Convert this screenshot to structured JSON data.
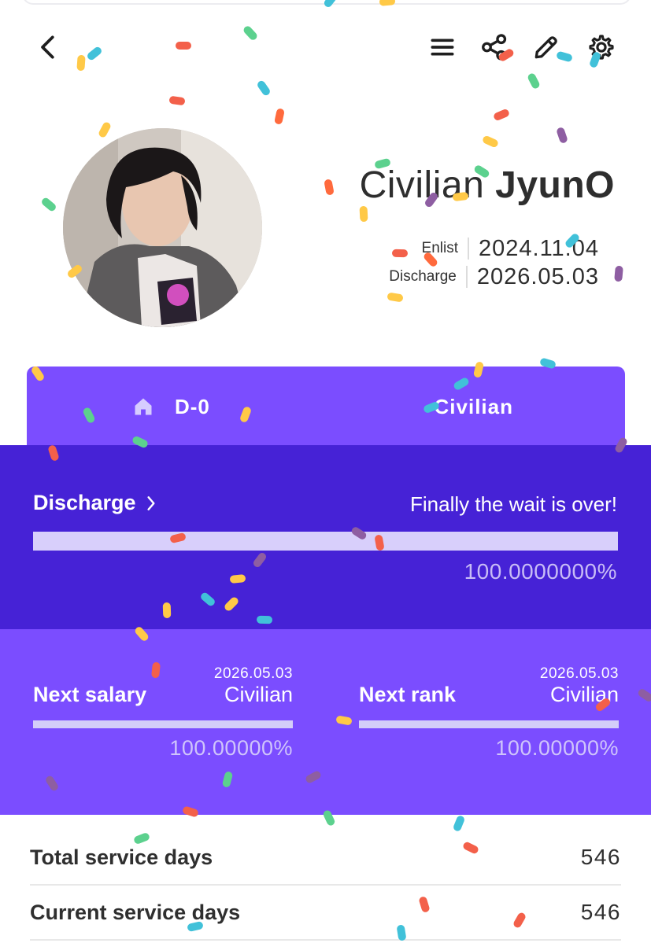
{
  "header": {
    "back_icon": "chevron-left-icon",
    "menu_icon": "hamburger-menu-icon",
    "share_icon": "share-icon",
    "edit_icon": "pencil-icon",
    "settings_icon": "gear-icon"
  },
  "profile": {
    "rank": "Civilian",
    "name": "JyunO",
    "enlist_label": "Enlist",
    "enlist_date": "2024.11.04",
    "discharge_label": "Discharge",
    "discharge_date": "2026.05.03"
  },
  "tabs": {
    "left_icon": "home-icon",
    "left_label": "D-0",
    "right_label": "Civilian"
  },
  "discharge": {
    "title": "Discharge",
    "message": "Finally the wait is over!",
    "progress": 1.0,
    "percent_text": "100.0000000%"
  },
  "next_salary": {
    "label": "Next salary",
    "date": "2026.05.03",
    "value": "Civilian",
    "progress": 1.0,
    "percent_text": "100.00000%"
  },
  "next_rank": {
    "label": "Next rank",
    "date": "2026.05.03",
    "value": "Civilian",
    "progress": 1.0,
    "percent_text": "100.00000%"
  },
  "stats": [
    {
      "label": "Total service days",
      "value": "546"
    },
    {
      "label": "Current service days",
      "value": "546"
    }
  ],
  "colors": {
    "accent": "#7b4dff",
    "accent_dark": "#4622d6",
    "confetti": [
      "#f3604a",
      "#ffc947",
      "#41c1d9",
      "#5cd18e",
      "#8e5ea2",
      "#ff6a3d"
    ]
  }
}
